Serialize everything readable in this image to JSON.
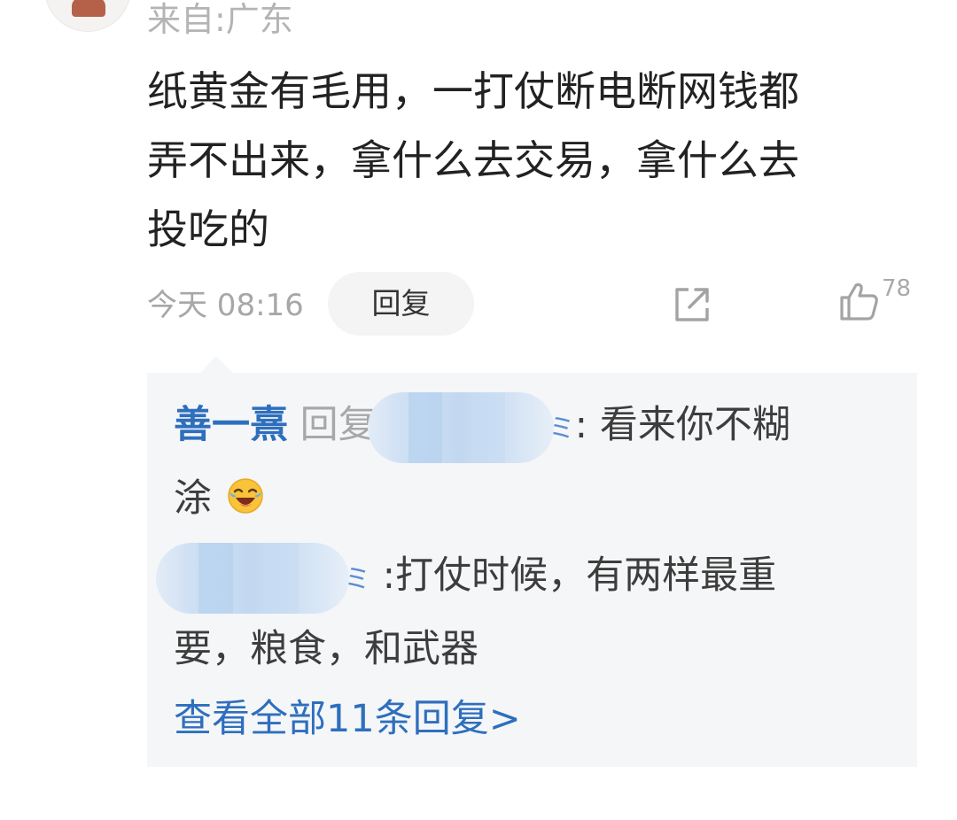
{
  "comment": {
    "location": "来自:广东",
    "text_lines": [
      "纸黄金有毛用，一打仗断电断网钱都",
      "弄不出来，拿什么去交易，拿什么去",
      "投吃的"
    ],
    "time": "今天 08:16",
    "reply_label": "回复",
    "like_count": "78"
  },
  "icons": {
    "share": "share-icon",
    "like": "thumbs-up-icon",
    "emoji": "laughing-tears-emoji"
  },
  "replies": [
    {
      "author": "善一熹",
      "reply_word": "回复",
      "target_suffix": "ミ",
      "separator": ":",
      "text_line1": "看来你不糊",
      "text_line2": "涂"
    },
    {
      "target_suffix": "ミ",
      "separator": ":",
      "text_line1": "打仗时候，有两样最重",
      "text_line2": "要，粮食，和武器"
    }
  ],
  "view_all": "查看全部11条回复>",
  "colors": {
    "link_blue": "#2e6fbd",
    "thread_bg": "#f5f6f8",
    "muted_gray": "#a8a8a8",
    "text_dark": "#222222"
  }
}
